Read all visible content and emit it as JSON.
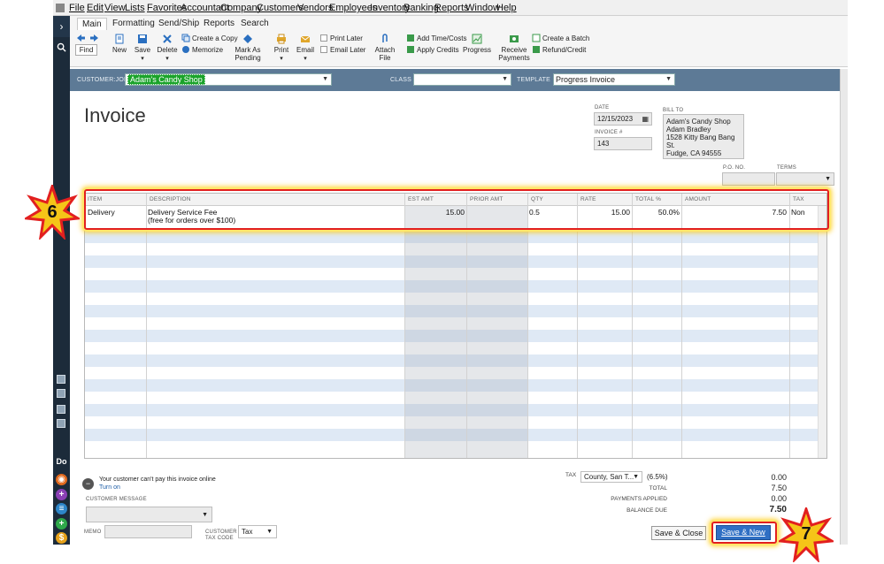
{
  "menu": [
    "File",
    "Edit",
    "View",
    "Lists",
    "Favorites",
    "Accountant",
    "Company",
    "Customers",
    "Vendors",
    "Employees",
    "Inventory",
    "Banking",
    "Reports",
    "Window",
    "Help"
  ],
  "ribbon": {
    "tabs": [
      "Main",
      "Formatting",
      "Send/Ship",
      "Reports",
      "Search"
    ],
    "find": "Find",
    "new": "New",
    "save": "Save",
    "delete": "Delete",
    "create_copy": "Create a Copy",
    "memorize": "Memorize",
    "mark_as_pending_1": "Mark As",
    "mark_as_pending_2": "Pending",
    "print": "Print",
    "email": "Email",
    "print_later": "Print Later",
    "email_later": "Email Later",
    "attach_1": "Attach",
    "attach_2": "File",
    "add_time_costs": "Add Time/Costs",
    "apply_credits": "Apply Credits",
    "progress": "Progress",
    "receive_1": "Receive",
    "receive_2": "Payments",
    "create_batch": "Create a Batch",
    "refund_credit": "Refund/Credit"
  },
  "customer_bar": {
    "customer_job_label": "CUSTOMER:JOB",
    "customer_job_value": "Adam's Candy Shop",
    "class_label": "CLASS",
    "class_value": "",
    "template_label": "TEMPLATE",
    "template_value": "Progress Invoice"
  },
  "invoice": {
    "title": "Invoice",
    "date_label": "DATE",
    "date_value": "12/15/2023",
    "invoice_no_label": "INVOICE #",
    "invoice_no_value": "143",
    "bill_to_label": "BILL TO",
    "bill_to": [
      "Adam's Candy Shop",
      "Adam Bradley",
      "1528 Kitty Bang Bang St.",
      "Fudge, CA 94555"
    ],
    "po_label": "P.O. NO.",
    "terms_label": "TERMS"
  },
  "grid": {
    "headers": [
      "ITEM",
      "DESCRIPTION",
      "EST AMT",
      "PRIOR AMT",
      "QTY",
      "RATE",
      "TOTAL %",
      "AMOUNT",
      "TAX"
    ],
    "row": {
      "item": "Delivery",
      "description_1": "Delivery Service Fee",
      "description_2": "(free for orders over $100)",
      "est_amt": "15.00",
      "prior_amt": "",
      "qty": "0.5",
      "rate": "15.00",
      "total_pct": "50.0%",
      "amount": "7.50",
      "tax": "Non"
    }
  },
  "footer": {
    "online_msg": "Your customer can't pay this invoice online",
    "turn_on": "Turn on",
    "customer_message_label": "CUSTOMER MESSAGE",
    "memo_label": "MEMO",
    "customer_tax_code_label_1": "CUSTOMER",
    "customer_tax_code_label_2": "TAX CODE",
    "customer_tax_code_value": "Tax",
    "tax_label": "TAX",
    "tax_item": "County, San T...",
    "tax_rate": "(6.5%)",
    "tax_value": "0.00",
    "total_label": "TOTAL",
    "total_value": "7.50",
    "payments_label": "PAYMENTS APPLIED",
    "payments_value": "0.00",
    "balance_label": "BALANCE DUE",
    "balance_value": "7.50",
    "save_close": "Save & Close",
    "save_new": "Save & New"
  },
  "rail": {
    "do_label": "Do"
  },
  "callouts": {
    "six": "6",
    "seven": "7"
  },
  "colors": {
    "accent_blue": "#2f6fc4",
    "customer_bar": "#5d7a96",
    "callout_red": "#e21f1f",
    "callout_gold": "#f5c518"
  }
}
